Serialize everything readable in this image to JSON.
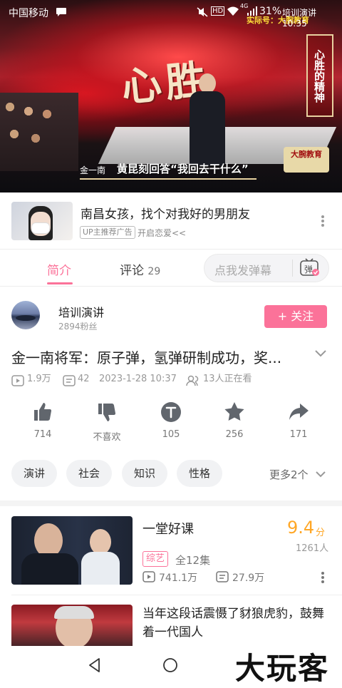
{
  "status_bar": {
    "carrier": "中国移动",
    "battery": "31%",
    "network": "4G",
    "hd": "HD",
    "time_partial": "培训演讲 10:35"
  },
  "video": {
    "big_title": "心胜",
    "side_panel": "心胜的精神",
    "speaker_name": "金一南",
    "subtitle": "黄昆刻回答“我回去干什么”",
    "top_banner": "实际号：大腕教育",
    "logo_badge": "大腕教育"
  },
  "ad": {
    "title": "南昌女孩，找个对我好的男朋友",
    "tag": "UP主推荐广告",
    "sub": "开启恋爱<<",
    "more_icon": "more-vertical-icon"
  },
  "tabs": {
    "intro": "简介",
    "comments": "评论",
    "comments_count": "29",
    "danmu_placeholder": "点我发弹幕",
    "danmu_icon_label": "弹"
  },
  "uploader": {
    "name": "培训演讲",
    "fans": "2894粉丝",
    "follow": "+ 关注"
  },
  "video_info": {
    "title": "金一南将军：原子弹，氢弹研制成功，奖...",
    "views": "1.9万",
    "danmaku": "42",
    "date": "2023-1-28 10:37",
    "watching": "13人正在看"
  },
  "actions": [
    {
      "icon": "thumbs-up-icon",
      "label": "714"
    },
    {
      "icon": "thumbs-down-icon",
      "label": "不喜欢"
    },
    {
      "icon": "coin-icon",
      "label": "105"
    },
    {
      "icon": "star-icon",
      "label": "256"
    },
    {
      "icon": "share-icon",
      "label": "171"
    }
  ],
  "tags": [
    "演讲",
    "社会",
    "知识",
    "性格"
  ],
  "tags_more": "更多2个",
  "related": [
    {
      "title": "一堂好课",
      "score": "9.4",
      "score_unit": "分",
      "rating_count": "1261人",
      "badge": "综艺",
      "episodes": "全12集",
      "plays": "741.1万",
      "danmaku": "27.9万"
    },
    {
      "title": "当年这段话震慑了豺狼虎豹，鼓舞着一代国人"
    }
  ],
  "watermark": "大玩客",
  "colors": {
    "accent": "#fb7299",
    "score": "#ffa726"
  }
}
